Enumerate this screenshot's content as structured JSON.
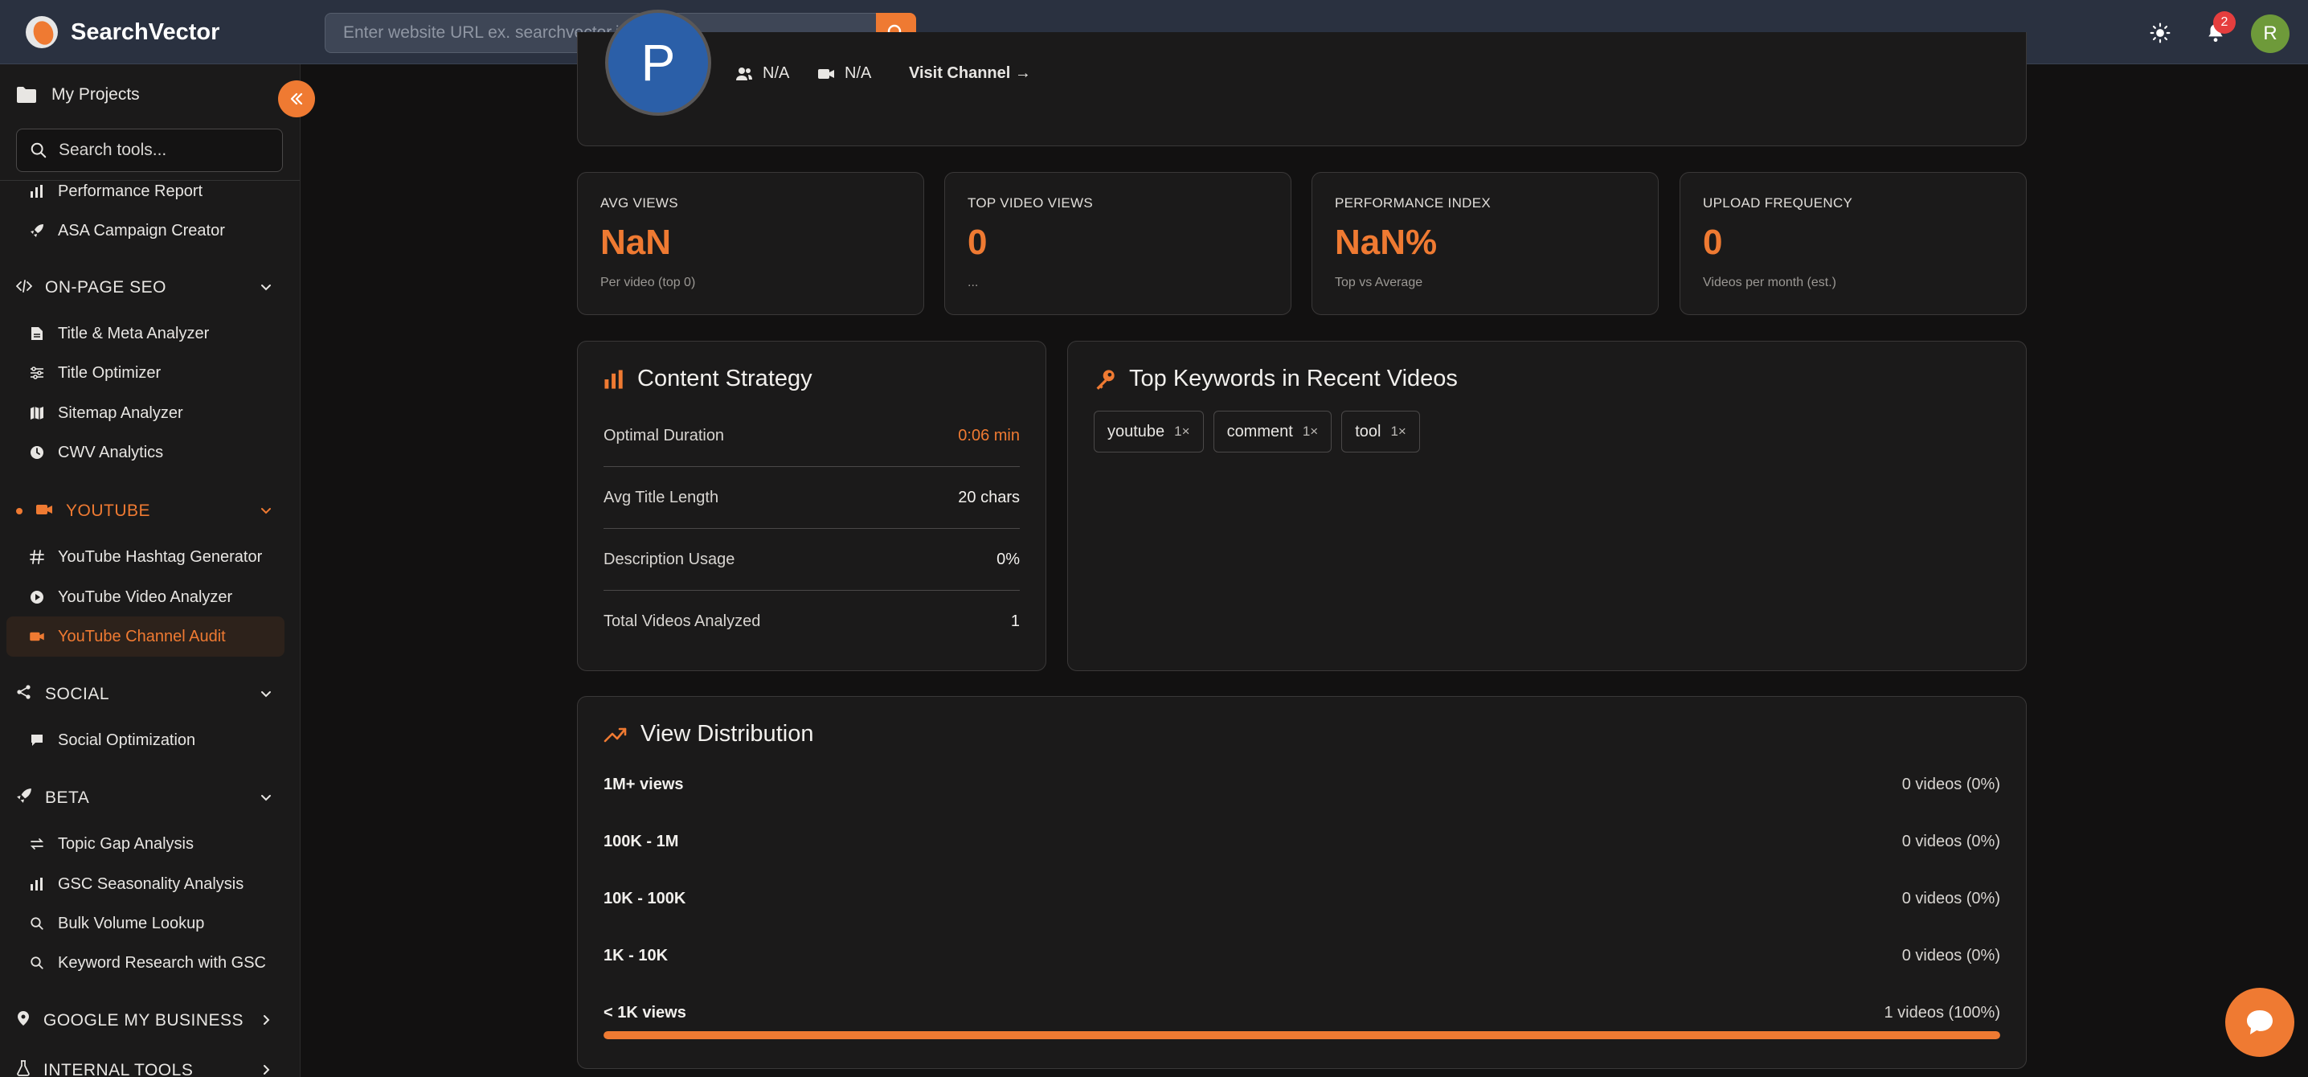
{
  "app": {
    "name": "SearchVector",
    "search_placeholder": "Enter website URL ex. searchvector.io",
    "notification_count": "2",
    "user_initial": "R"
  },
  "sidebar": {
    "projects_label": "My Projects",
    "search_placeholder": "Search tools...",
    "top_items": [
      {
        "label": "Performance Report",
        "icon": "bar-chart-icon"
      },
      {
        "label": "ASA Campaign Creator",
        "icon": "rocket-icon"
      }
    ],
    "sections": {
      "onpage": {
        "label": "ON-PAGE SEO",
        "items": [
          {
            "label": "Title & Meta Analyzer",
            "icon": "file-icon"
          },
          {
            "label": "Title Optimizer",
            "icon": "sliders-icon"
          },
          {
            "label": "Sitemap Analyzer",
            "icon": "map-icon"
          },
          {
            "label": "CWV Analytics",
            "icon": "clock-icon"
          }
        ]
      },
      "youtube": {
        "label": "YOUTUBE",
        "items": [
          {
            "label": "YouTube Hashtag Generator",
            "icon": "hash-icon"
          },
          {
            "label": "YouTube Video Analyzer",
            "icon": "play-circle-icon"
          },
          {
            "label": "YouTube Channel Audit",
            "icon": "video-icon"
          }
        ]
      },
      "social": {
        "label": "SOCIAL",
        "items": [
          {
            "label": "Social Optimization",
            "icon": "chat-icon"
          }
        ]
      },
      "beta": {
        "label": "BETA",
        "items": [
          {
            "label": "Topic Gap Analysis",
            "icon": "arrows-icon"
          },
          {
            "label": "GSC Seasonality Analysis",
            "icon": "bar-chart-icon"
          },
          {
            "label": "Bulk Volume Lookup",
            "icon": "search-icon"
          },
          {
            "label": "Keyword Research with GSC",
            "icon": "search-icon"
          }
        ]
      },
      "gmb": {
        "label": "GOOGLE MY BUSINESS"
      },
      "internal": {
        "label": "INTERNAL TOOLS"
      }
    }
  },
  "profile": {
    "initial": "P",
    "subscribers": "N/A",
    "videos": "N/A",
    "visit_label": "Visit Channel →"
  },
  "stats": [
    {
      "label": "AVG VIEWS",
      "value": "NaN",
      "sub": "Per video (top 0)"
    },
    {
      "label": "TOP VIDEO VIEWS",
      "value": "0",
      "sub": "..."
    },
    {
      "label": "PERFORMANCE INDEX",
      "value": "NaN%",
      "sub": "Top vs Average"
    },
    {
      "label": "UPLOAD FREQUENCY",
      "value": "0",
      "sub": "Videos per month (est.)"
    }
  ],
  "content_strategy": {
    "title": "Content Strategy",
    "rows": [
      {
        "key": "Optimal Duration",
        "value": "0:06 min"
      },
      {
        "key": "Avg Title Length",
        "value": "20 chars"
      },
      {
        "key": "Description Usage",
        "value": "0%"
      },
      {
        "key": "Total Videos Analyzed",
        "value": "1"
      }
    ]
  },
  "keywords": {
    "title": "Top Keywords in Recent Videos",
    "tags": [
      {
        "word": "youtube",
        "count": "1×"
      },
      {
        "word": "comment",
        "count": "1×"
      },
      {
        "word": "tool",
        "count": "1×"
      }
    ]
  },
  "view_distribution": {
    "title": "View Distribution",
    "rows": [
      {
        "range": "1M+ views",
        "count": "0 videos (0%)",
        "share": 0
      },
      {
        "range": "100K - 1M",
        "count": "0 videos (0%)",
        "share": 0
      },
      {
        "range": "10K - 100K",
        "count": "0 videos (0%)",
        "share": 0
      },
      {
        "range": "1K - 10K",
        "count": "0 videos (0%)",
        "share": 0
      },
      {
        "range": "< 1K views",
        "count": "1 videos (100%)",
        "share": 1.0
      }
    ]
  },
  "colors": {
    "accent": "#ef7a32",
    "background": "#121111",
    "topbar": "#2a3140",
    "card": "#1b1a1a"
  }
}
